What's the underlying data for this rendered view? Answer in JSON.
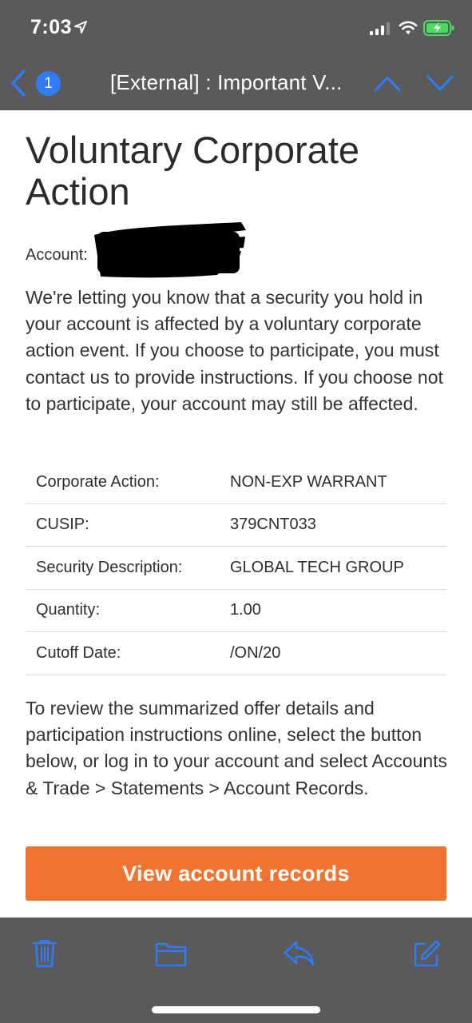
{
  "status_bar": {
    "time": "7:03"
  },
  "nav": {
    "unread_count": "1",
    "subject": "[External] : Important V..."
  },
  "email": {
    "headline": "Voluntary Corporate Action",
    "account_label": "Account:",
    "intro": "We're letting you know that a security you hold in your account is affected by a voluntary corporate action event. If you choose to participate, you must contact us to provide instructions. If you choose not to participate, your account may still be affected.",
    "details": [
      {
        "label": "Corporate Action:",
        "value": "NON-EXP WARRANT"
      },
      {
        "label": "CUSIP:",
        "value": "379CNT033"
      },
      {
        "label": "Security Description:",
        "value": "GLOBAL TECH GROUP"
      },
      {
        "label": "Quantity:",
        "value": "1.00"
      },
      {
        "label": "Cutoff Date:",
        "value": "/ON/20"
      }
    ],
    "outro": "To review the summarized offer details and participation instructions online, select the button below, or log in to your account and select Accounts & Trade > Statements > Account Records.",
    "cta_label": "View account records"
  },
  "toolbar": {
    "icons": [
      "trash-icon",
      "folder-icon",
      "reply-icon",
      "compose-icon"
    ]
  },
  "colors": {
    "accent_blue": "#2f7cf6",
    "cta_orange": "#ef7430",
    "chrome_gray": "#5a5a5c",
    "battery_green": "#4cd964"
  }
}
